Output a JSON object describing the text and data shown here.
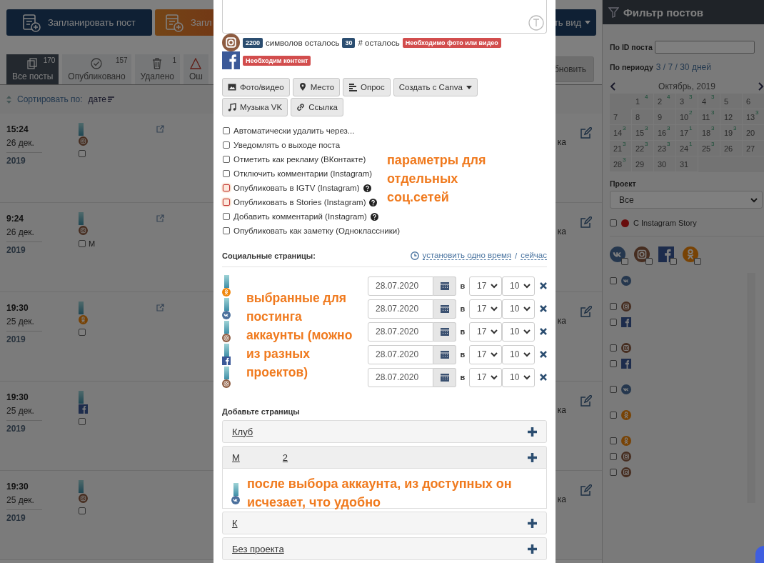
{
  "toolbar": {
    "buttons": [
      {
        "label": "Запланировать пост",
        "kind": "primary"
      },
      {
        "label": "Запл",
        "kind": "accent"
      }
    ],
    "view_button": {
      "label": "ть вид"
    }
  },
  "tabs": [
    {
      "label": "Все посты",
      "count": "170",
      "kind": "copy",
      "selected": true
    },
    {
      "label": "Опубликовано",
      "count": "157",
      "kind": "check",
      "selected": false
    },
    {
      "label": "Удалено",
      "count": "1",
      "kind": "trash",
      "selected": false
    },
    {
      "label": "Ош",
      "kind": "warning",
      "selected": false
    }
  ],
  "refresh_button": {
    "label": "бновить"
  },
  "sort": {
    "label": "Сортировать по:",
    "value": "дате"
  },
  "posts": [
    {
      "time": "15:24",
      "date": "26 дек.",
      "year": "2019",
      "kind": "instagram",
      "checked": false,
      "link": true,
      "tail": "ка"
    },
    {
      "time": "9:24",
      "date": "26 дек.",
      "year": "2019",
      "kind": "instagram",
      "checked": false,
      "caption": "М",
      "link": true,
      "tail": "ка"
    },
    {
      "time": "19:30",
      "date": "25 дек.",
      "year": "2019",
      "kind": "ok",
      "checked": false,
      "link": true,
      "tail": "ка"
    },
    {
      "time": "19:30",
      "date": "25 дек.",
      "year": "2019",
      "kind": "facebook",
      "checked": false,
      "link": false,
      "tail": "ка"
    },
    {
      "time": "19:30",
      "date": "25 дек.",
      "year": "2019",
      "kind": "instagram",
      "checked": false,
      "link": false,
      "tail": "ка"
    }
  ],
  "filter": {
    "title": "Фильтр постов",
    "id_label": "По ID поста",
    "period_label": "По периоду",
    "period_value": "3 / 7 / 30 дней",
    "calendar": {
      "month": "Октябрь, 2019",
      "days": [
        {
          "kind": "blank"
        },
        {
          "kind": "day",
          "day": "1",
          "count": "4"
        },
        {
          "kind": "day",
          "day": "2",
          "count": "4"
        },
        {
          "kind": "day",
          "day": "3",
          "count": "3"
        },
        {
          "kind": "day",
          "day": "4",
          "count": "3"
        },
        {
          "kind": "day",
          "day": "5"
        },
        {
          "kind": "day",
          "day": "6"
        },
        {
          "kind": "day",
          "day": "7"
        },
        {
          "kind": "day",
          "day": "8"
        },
        {
          "kind": "day",
          "day": "9"
        },
        {
          "kind": "day",
          "day": "10",
          "count": "2"
        },
        {
          "kind": "day",
          "day": "11",
          "count": "3"
        },
        {
          "kind": "day",
          "day": "12"
        },
        {
          "kind": "day",
          "day": "13",
          "count": "3"
        },
        {
          "kind": "day",
          "day": "14",
          "count": "3"
        },
        {
          "kind": "day",
          "day": "15",
          "count": "3"
        },
        {
          "kind": "day",
          "day": "16",
          "count": "3"
        },
        {
          "kind": "day",
          "day": "17",
          "count": "1"
        },
        {
          "kind": "day",
          "day": "18",
          "count": "3"
        },
        {
          "kind": "day",
          "day": "19",
          "count": "3"
        },
        {
          "kind": "day",
          "day": "20"
        },
        {
          "kind": "day",
          "day": "21",
          "count": "3"
        },
        {
          "kind": "day",
          "day": "22",
          "count": "3"
        },
        {
          "kind": "day",
          "day": "23",
          "count": "3"
        },
        {
          "kind": "day",
          "day": "24",
          "count": "1"
        },
        {
          "kind": "day",
          "day": "25",
          "count": "3"
        },
        {
          "kind": "day",
          "day": "26"
        },
        {
          "kind": "day",
          "day": "27"
        },
        {
          "kind": "day",
          "day": "28",
          "count": "3"
        },
        {
          "kind": "day",
          "day": "29"
        },
        {
          "kind": "day",
          "day": "30"
        },
        {
          "kind": "day",
          "day": "31"
        },
        {
          "kind": "blank"
        },
        {
          "kind": "blank"
        },
        {
          "kind": "blank"
        }
      ]
    },
    "project_label": "Проект",
    "project_value": "Все",
    "story_filter": {
      "label": "С Instagram Story",
      "checked": false
    },
    "networks": [
      {
        "kind": "vk",
        "checked": false
      },
      {
        "kind": "instagram",
        "checked": false
      },
      {
        "kind": "facebook",
        "checked": false
      },
      {
        "kind": "ok",
        "checked": false
      }
    ],
    "account_groups": [
      {
        "accounts": [
          {
            "kind": "vk",
            "checked": false
          }
        ]
      },
      {
        "accounts": [
          {
            "kind": "instagram",
            "checked": false
          },
          {
            "kind": "facebook",
            "checked": false
          }
        ]
      },
      {
        "accounts": [
          {
            "kind": "instagram",
            "checked": false
          },
          {
            "kind": "facebook",
            "checked": false
          }
        ]
      },
      {
        "accounts": [
          {
            "kind": "vk",
            "checked": false
          }
        ]
      },
      {
        "accounts": [
          {
            "kind": "ok",
            "checked": false
          }
        ]
      },
      {
        "accounts": [
          {
            "kind": "ok",
            "checked": false
          },
          {
            "kind": "instagram",
            "checked": false
          },
          {
            "kind": "instagram",
            "checked": false
          }
        ]
      }
    ]
  },
  "modal": {
    "limits": [
      {
        "kind": "instagram",
        "items": [
          {
            "kind": "count",
            "text": "2200"
          },
          {
            "kind": "text",
            "text": "символов осталось"
          },
          {
            "kind": "count",
            "text": "30"
          },
          {
            "kind": "text",
            "text": "# осталось"
          },
          {
            "kind": "error",
            "text": "Необходимо фото или видео"
          }
        ]
      },
      {
        "kind": "facebook",
        "items": [
          {
            "kind": "error",
            "text": "Необходим контент"
          }
        ]
      }
    ],
    "attach_buttons": [
      {
        "label": "Фото/видео",
        "kind": "image"
      },
      {
        "label": "Место",
        "kind": "pin"
      },
      {
        "label": "Опрос",
        "kind": "poll"
      },
      {
        "label": "Создать с Canva",
        "kind": "dropdown"
      },
      {
        "label": "Музыка VK",
        "kind": "music"
      },
      {
        "label": "Ссылка",
        "kind": "link"
      }
    ],
    "options": [
      {
        "label": "Автоматически удалить через...",
        "checked": false,
        "highlighted": false,
        "help": false
      },
      {
        "label": "Уведомлять о выходе поста",
        "checked": false,
        "highlighted": false,
        "help": false
      },
      {
        "label": "Отметить как рекламу (ВКонтакте)",
        "checked": false,
        "highlighted": false,
        "help": false
      },
      {
        "label": "Отключить комментарии (Instagram)",
        "checked": false,
        "highlighted": false,
        "help": false
      },
      {
        "label": "Опубликовать в IGTV (Instagram)",
        "checked": false,
        "highlighted": true,
        "help": true
      },
      {
        "label": "Опубликовать в Stories (Instagram)",
        "checked": false,
        "highlighted": true,
        "help": true
      },
      {
        "label": "Добавить комментарий (Instagram)",
        "checked": false,
        "highlighted": false,
        "help": true
      },
      {
        "label": "Опубликовать как заметку (Одноклассники)",
        "checked": false,
        "highlighted": false,
        "help": false
      }
    ],
    "options_note": "параметры для отдельных соц.сетей",
    "social": {
      "title": "Социальные страницы:",
      "set_time": "установить одно время",
      "separator": "/",
      "now": "сейчас",
      "rows": [
        {
          "kind": "ok",
          "date": "28.07.2020",
          "at": "в",
          "hour": "17",
          "minute": "10"
        },
        {
          "kind": "vk",
          "date": "28.07.2020",
          "at": "в",
          "hour": "17",
          "minute": "10"
        },
        {
          "kind": "instagram",
          "date": "28.07.2020",
          "at": "в",
          "hour": "17",
          "minute": "10"
        },
        {
          "kind": "facebook",
          "date": "28.07.2020",
          "at": "в",
          "hour": "17",
          "minute": "10"
        },
        {
          "kind": "instagram",
          "date": "28.07.2020",
          "at": "в",
          "hour": "17",
          "minute": "10"
        }
      ],
      "note": "выбранные для постинга аккаунты (можно из разных проектов)"
    },
    "add_pages": {
      "title": "Добавьте страницы",
      "groups": [
        {
          "labels": [
            "Клуб"
          ],
          "expanded": false
        },
        {
          "labels": [
            "М",
            "2"
          ],
          "expanded": true,
          "accounts": [
            {
              "kind": "vk"
            }
          ],
          "note": "после выбора аккаунта, из доступных он исчезает, что удобно"
        },
        {
          "labels": [
            "К"
          ],
          "expanded": false
        },
        {
          "labels": [
            "Без проекта"
          ],
          "expanded": false
        }
      ]
    }
  }
}
